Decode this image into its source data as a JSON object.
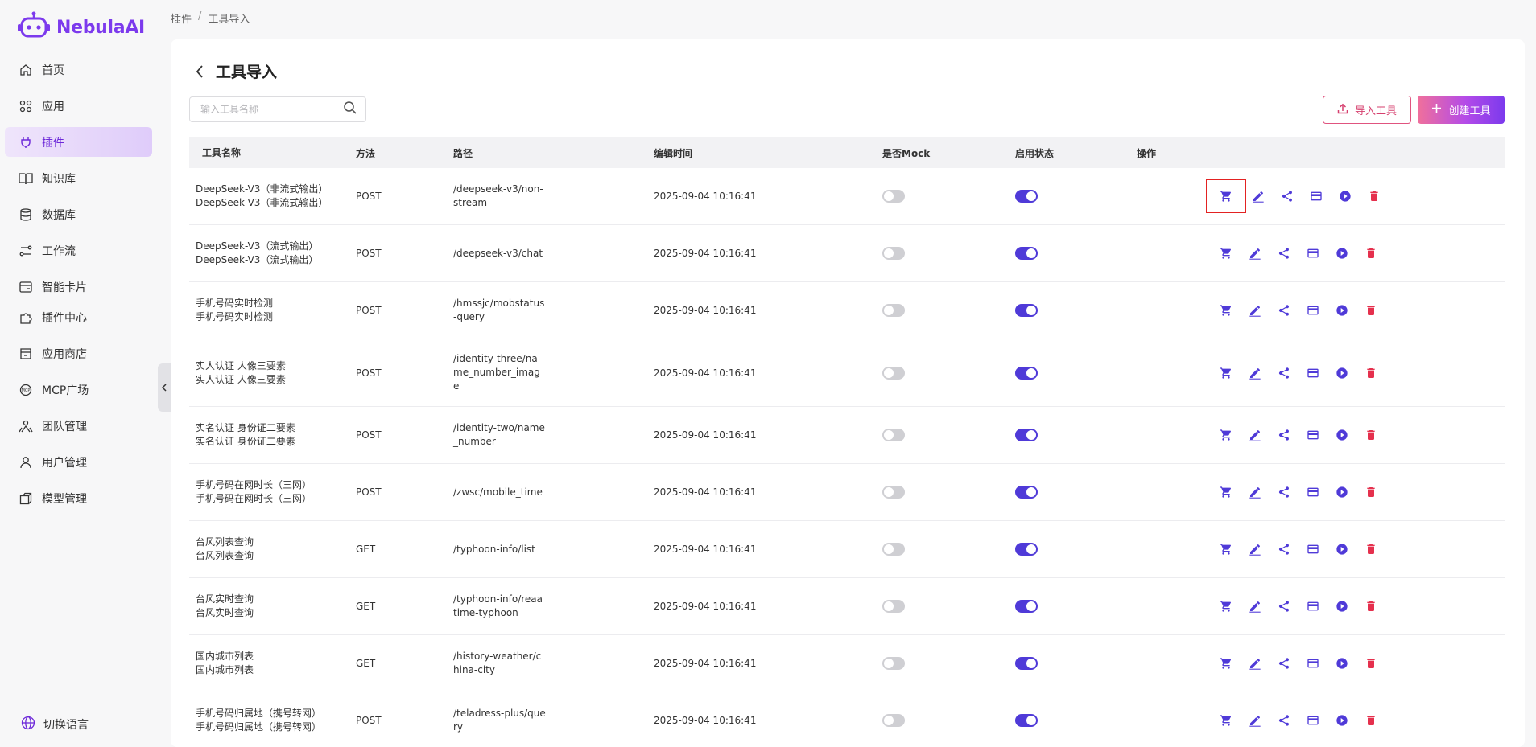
{
  "app": {
    "name": "NebulaAI"
  },
  "colors": {
    "accent": "#4f3ad8",
    "brand": "#7c3aed",
    "danger": "#e5304d",
    "import_border": "#e0537f"
  },
  "sidebar": {
    "items": [
      {
        "label": "首页",
        "icon": "home-icon"
      },
      {
        "label": "应用",
        "icon": "apps-grid-icon"
      },
      {
        "label": "插件",
        "icon": "plug-icon",
        "active": true
      },
      {
        "label": "知识库",
        "icon": "book-icon"
      },
      {
        "label": "数据库",
        "icon": "database-icon"
      },
      {
        "label": "工作流",
        "icon": "workflow-icon"
      },
      {
        "label": "智能卡片",
        "icon": "card-icon"
      },
      {
        "label": "插件中心",
        "icon": "puzzle-icon"
      },
      {
        "label": "应用商店",
        "icon": "store-icon"
      },
      {
        "label": "MCP广场",
        "icon": "mcp-icon"
      },
      {
        "label": "团队管理",
        "icon": "team-icon"
      },
      {
        "label": "用户管理",
        "icon": "user-icon"
      },
      {
        "label": "模型管理",
        "icon": "model-icon"
      }
    ],
    "language_label": "切换语言"
  },
  "breadcrumb": {
    "parent": "插件",
    "separator": "/",
    "current": "工具导入"
  },
  "page": {
    "title": "工具导入"
  },
  "search": {
    "placeholder": "输入工具名称"
  },
  "toolbar": {
    "import_label": "导入工具",
    "create_label": "创建工具"
  },
  "table": {
    "headers": {
      "name": "工具名称",
      "method": "方法",
      "path": "路径",
      "time": "编辑时间",
      "mock": "是否Mock",
      "status": "启用状态",
      "op": "操作"
    },
    "rows": [
      {
        "name1": "DeepSeek-V3（非流式输出）",
        "name2": "DeepSeek-V3（非流式输出）",
        "method": "POST",
        "path": "/deepseek-v3/non-stream",
        "time": "2025-09-04 10:16:41",
        "mock": false,
        "enabled": true
      },
      {
        "name1": "DeepSeek-V3（流式输出）",
        "name2": "DeepSeek-V3（流式输出）",
        "method": "POST",
        "path": "/deepseek-v3/chat",
        "time": "2025-09-04 10:16:41",
        "mock": false,
        "enabled": true
      },
      {
        "name1": "手机号码实时检测",
        "name2": "手机号码实时检测",
        "method": "POST",
        "path": "/hmssjc/mobstatus-query",
        "time": "2025-09-04 10:16:41",
        "mock": false,
        "enabled": true
      },
      {
        "name1": "实人认证 人像三要素",
        "name2": "实人认证 人像三要素",
        "method": "POST",
        "path": "/identity-three/name_number_image",
        "time": "2025-09-04 10:16:41",
        "mock": false,
        "enabled": true
      },
      {
        "name1": "实名认证 身份证二要素",
        "name2": "实名认证 身份证二要素",
        "method": "POST",
        "path": "/identity-two/name_number",
        "time": "2025-09-04 10:16:41",
        "mock": false,
        "enabled": true
      },
      {
        "name1": "手机号码在网时长（三网）",
        "name2": "手机号码在网时长（三网）",
        "method": "POST",
        "path": "/zwsc/mobile_time",
        "time": "2025-09-04 10:16:41",
        "mock": false,
        "enabled": true
      },
      {
        "name1": "台风列表查询",
        "name2": "台风列表查询",
        "method": "GET",
        "path": "/typhoon-info/list",
        "time": "2025-09-04 10:16:41",
        "mock": false,
        "enabled": true
      },
      {
        "name1": "台风实时查询",
        "name2": "台风实时查询",
        "method": "GET",
        "path": "/typhoon-info/reaatime-typhoon",
        "time": "2025-09-04 10:16:41",
        "mock": false,
        "enabled": true
      },
      {
        "name1": "国内城市列表",
        "name2": "国内城市列表",
        "method": "GET",
        "path": "/history-weather/china-city",
        "time": "2025-09-04 10:16:41",
        "mock": false,
        "enabled": true
      },
      {
        "name1": "手机号码归属地（携号转网）",
        "name2": "手机号码归属地（携号转网）",
        "method": "POST",
        "path": "/teladress-plus/query",
        "time": "2025-09-04 10:16:41",
        "mock": false,
        "enabled": true
      }
    ],
    "actions": [
      "cart-icon",
      "edit-icon",
      "share-icon",
      "card-icon",
      "play-icon",
      "delete-icon"
    ]
  }
}
